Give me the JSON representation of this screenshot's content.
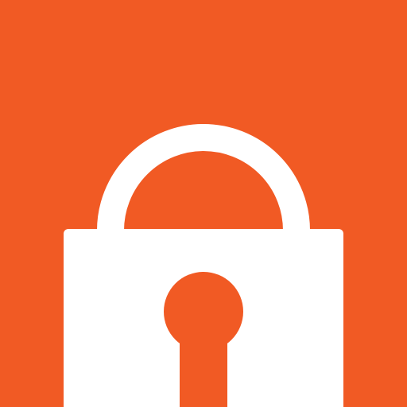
{
  "icon": {
    "name": "lock-icon",
    "background_color": "#F15A24",
    "foreground_color": "#FFFFFF"
  }
}
